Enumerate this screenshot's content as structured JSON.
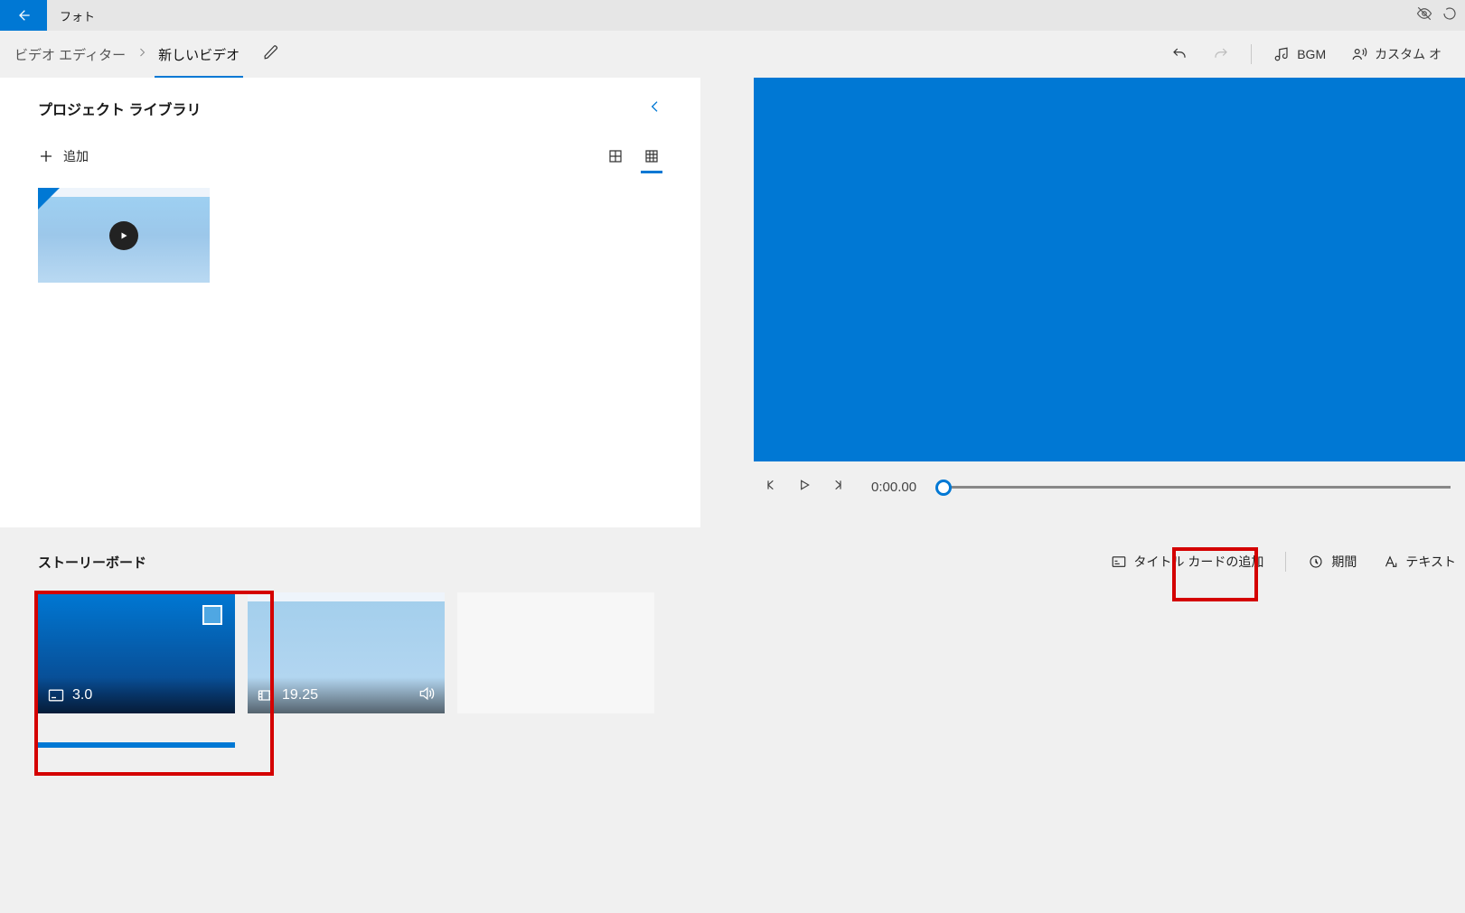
{
  "app_title": "フォト",
  "breadcrumb": {
    "root": "ビデオ エディター",
    "project": "新しいビデオ"
  },
  "toolbar": {
    "bgm": "BGM",
    "custom": "カスタム オ"
  },
  "library": {
    "title": "プロジェクト ライブラリ",
    "add_label": "追加"
  },
  "player": {
    "timecode": "0:00.00"
  },
  "storyboard": {
    "title": "ストーリーボード",
    "add_title_card": "タイトル カードの追加",
    "duration": "期間",
    "text": "テキスト",
    "items": [
      {
        "kind": "title",
        "duration": "3.0"
      },
      {
        "kind": "video",
        "duration": "19.25"
      },
      {
        "kind": "empty"
      }
    ]
  }
}
